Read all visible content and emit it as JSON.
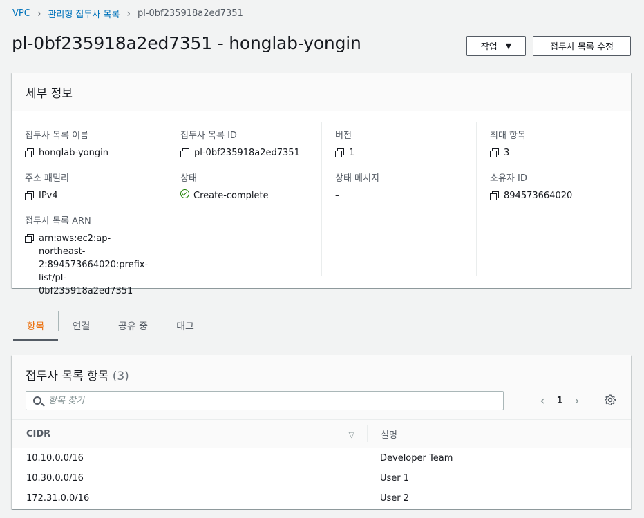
{
  "breadcrumb": {
    "items": [
      "VPC",
      "관리형 접두사 목록",
      "pl-0bf235918a2ed7351"
    ]
  },
  "header": {
    "title": "pl-0bf235918a2ed7351 - honglab-yongin",
    "actions_label": "작업",
    "edit_label": "접두사 목록 수정"
  },
  "details": {
    "title": "세부 정보",
    "fields": {
      "name_label": "접두사 목록 이름",
      "name_value": "honglab-yongin",
      "id_label": "접두사 목록 ID",
      "id_value": "pl-0bf235918a2ed7351",
      "version_label": "버전",
      "version_value": "1",
      "max_label": "최대 항목",
      "max_value": "3",
      "family_label": "주소 패밀리",
      "family_value": "IPv4",
      "state_label": "상태",
      "state_value": "Create-complete",
      "state_msg_label": "상태 메시지",
      "state_msg_value": "–",
      "owner_label": "소유자 ID",
      "owner_value": "894573664020",
      "arn_label": "접두사 목록 ARN",
      "arn_value": "arn:aws:ec2:ap-northeast-2:894573664020:prefix-list/pl-0bf235918a2ed7351"
    },
    "colors": {
      "success": "#1d8102",
      "link": "#0073bb",
      "accent": "#ec7211"
    }
  },
  "tabs": [
    "항목",
    "연결",
    "공유 중",
    "태그"
  ],
  "entries": {
    "title": "접두사 목록 항목",
    "count": "(3)",
    "search_placeholder": "항목 찾기",
    "page": "1",
    "columns": [
      "CIDR",
      "설명"
    ],
    "rows": [
      {
        "cidr": "10.10.0.0/16",
        "desc": "Developer Team"
      },
      {
        "cidr": "10.30.0.0/16",
        "desc": "User 1"
      },
      {
        "cidr": "172.31.0.0/16",
        "desc": "User 2"
      }
    ]
  }
}
